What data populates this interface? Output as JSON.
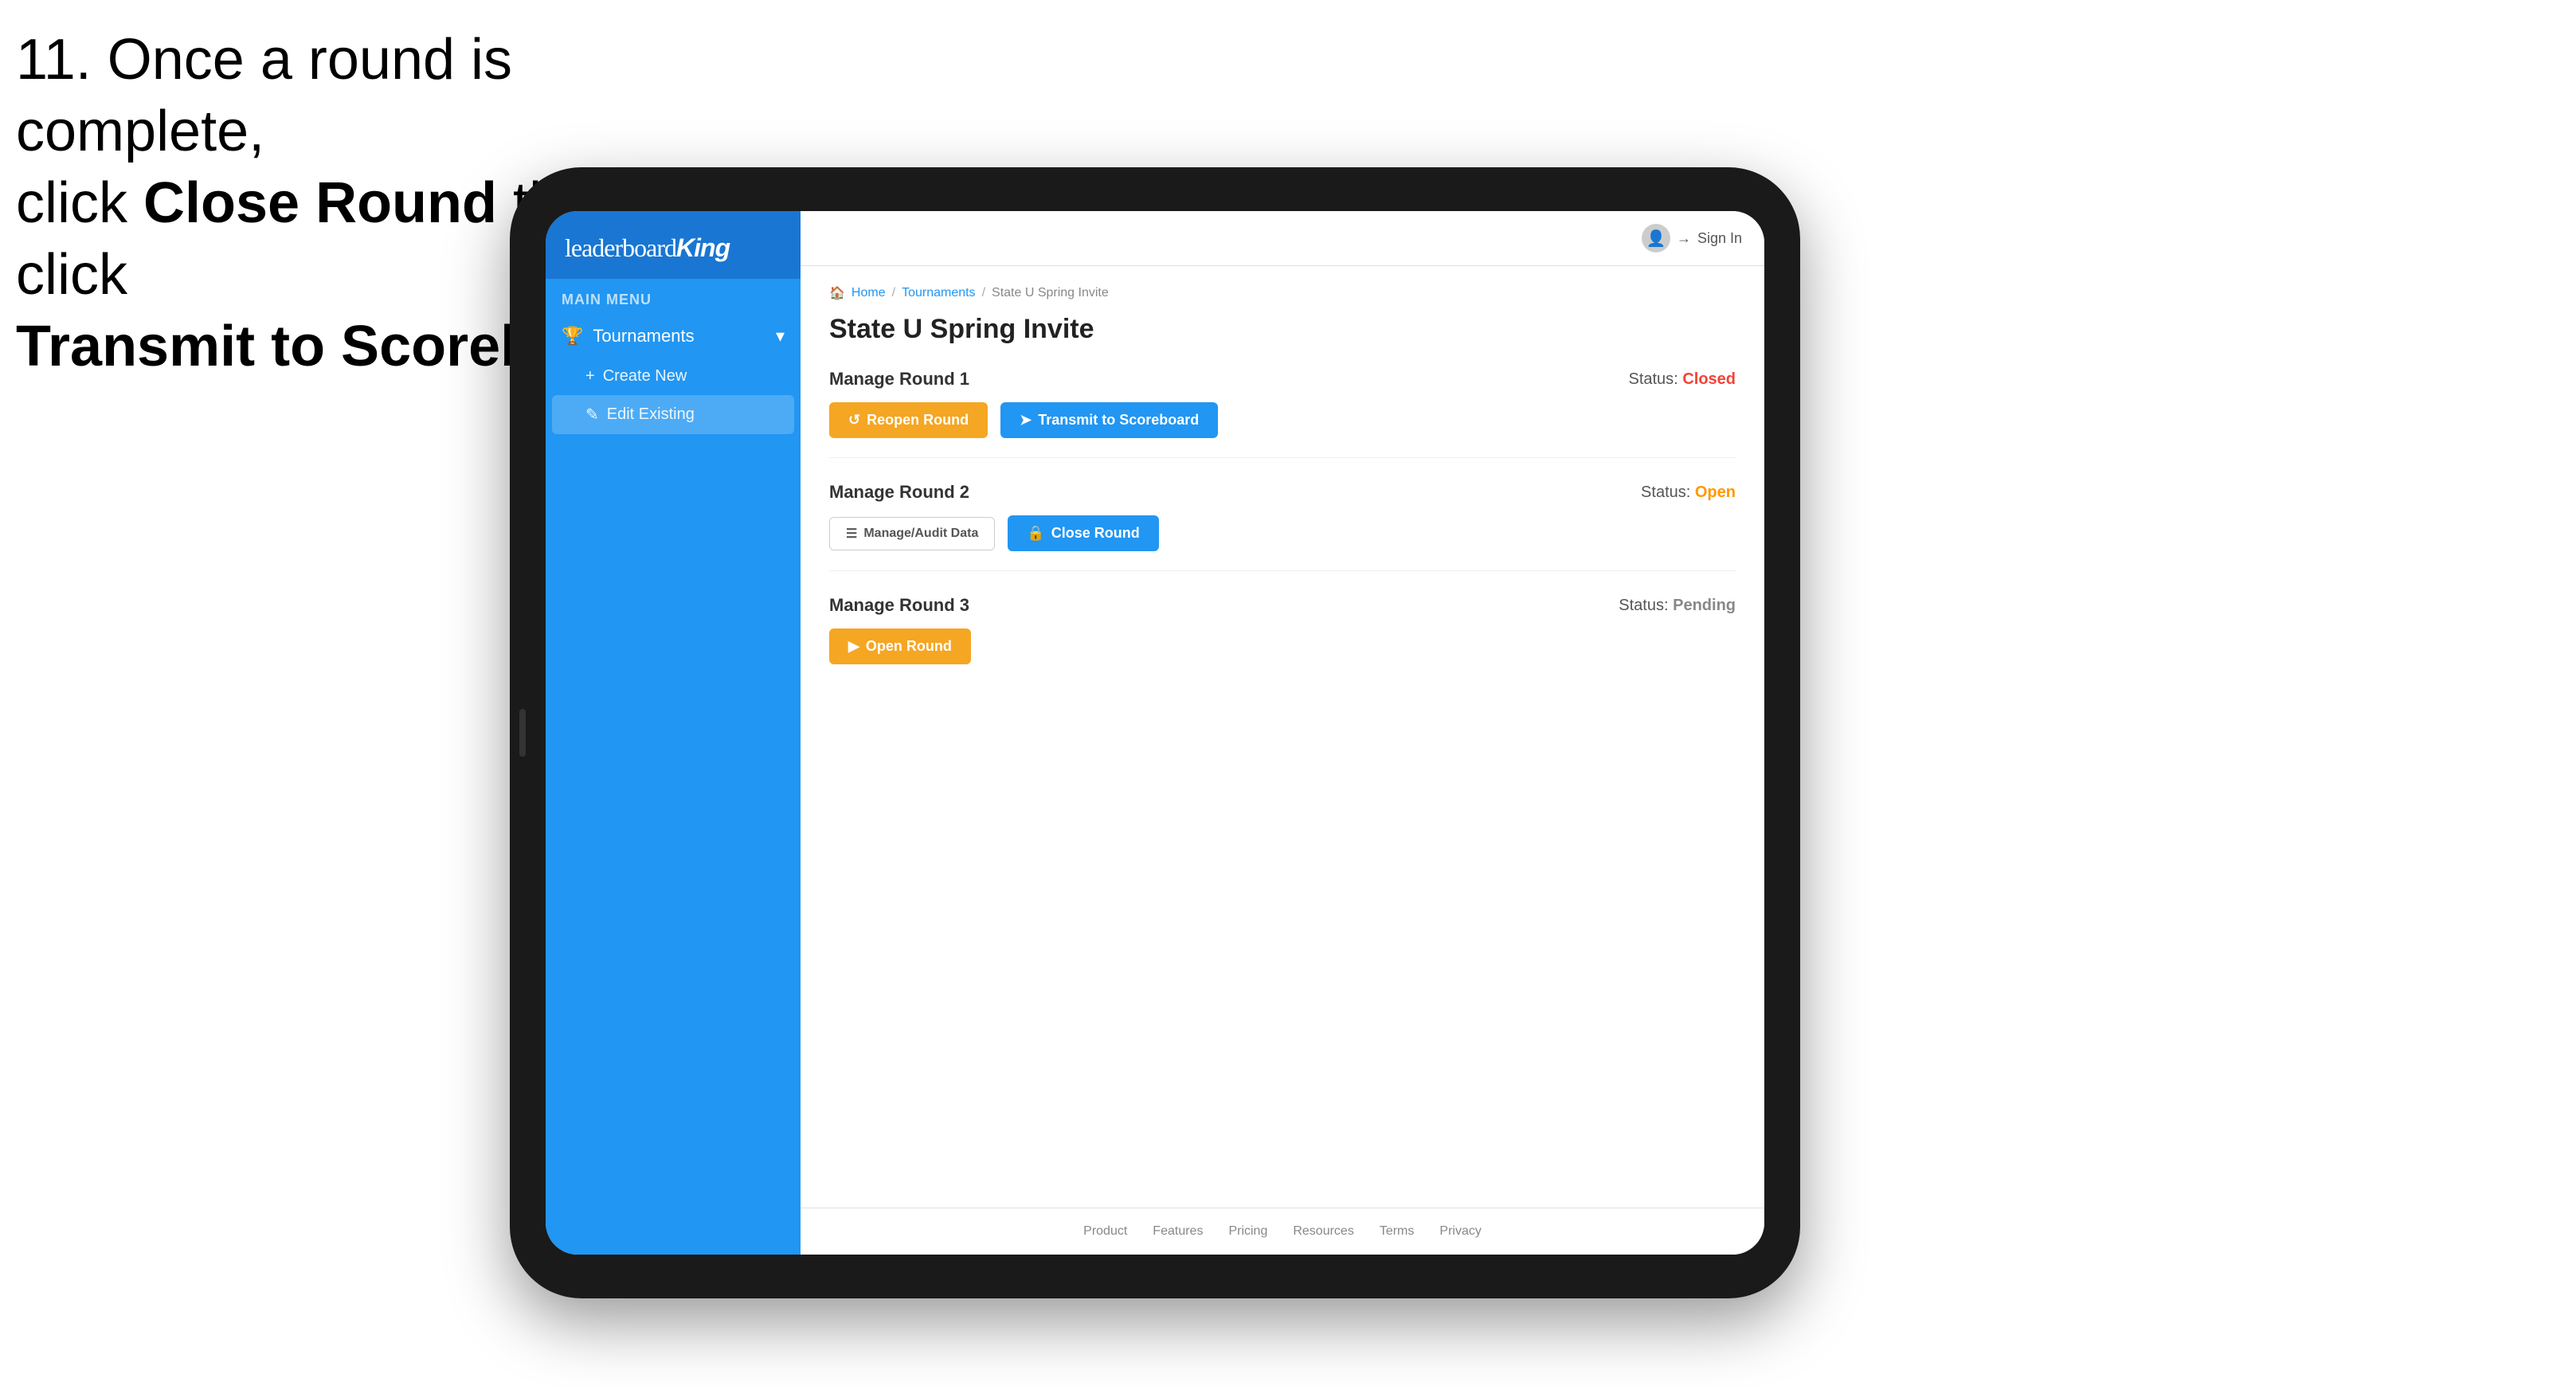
{
  "instruction": {
    "line1": "11. Once a round is complete,",
    "line2": "click ",
    "bold1": "Close Round",
    "line3": " then click",
    "bold2": "Transmit to Scoreboard."
  },
  "app": {
    "logo": {
      "prefix": "leaderboard",
      "suffix": "King"
    },
    "topbar": {
      "sign_in": "Sign In"
    },
    "sidebar": {
      "section_label": "MAIN MENU",
      "nav_items": [
        {
          "label": "Tournaments",
          "expanded": true
        }
      ],
      "sub_items": [
        {
          "label": "Create New",
          "active": false
        },
        {
          "label": "Edit Existing",
          "active": true
        }
      ]
    },
    "breadcrumb": {
      "home": "Home",
      "sep1": "/",
      "tournaments": "Tournaments",
      "sep2": "/",
      "current": "State U Spring Invite"
    },
    "page_title": "State U Spring Invite",
    "rounds": [
      {
        "title": "Manage Round 1",
        "status_label": "Status:",
        "status_value": "Closed",
        "status_class": "closed",
        "left_button": {
          "label": "Reopen Round",
          "type": "yellow"
        },
        "right_button": {
          "label": "Transmit to Scoreboard",
          "type": "blue"
        }
      },
      {
        "title": "Manage Round 2",
        "status_label": "Status:",
        "status_value": "Open",
        "status_class": "open",
        "left_button": {
          "label": "Manage/Audit Data",
          "type": "outline"
        },
        "right_button": {
          "label": "Close Round",
          "type": "blue"
        }
      },
      {
        "title": "Manage Round 3",
        "status_label": "Status:",
        "status_value": "Pending",
        "status_class": "pending",
        "left_button": {
          "label": "Open Round",
          "type": "yellow"
        },
        "right_button": null
      }
    ],
    "footer": {
      "links": [
        "Product",
        "Features",
        "Pricing",
        "Resources",
        "Terms",
        "Privacy"
      ]
    }
  }
}
